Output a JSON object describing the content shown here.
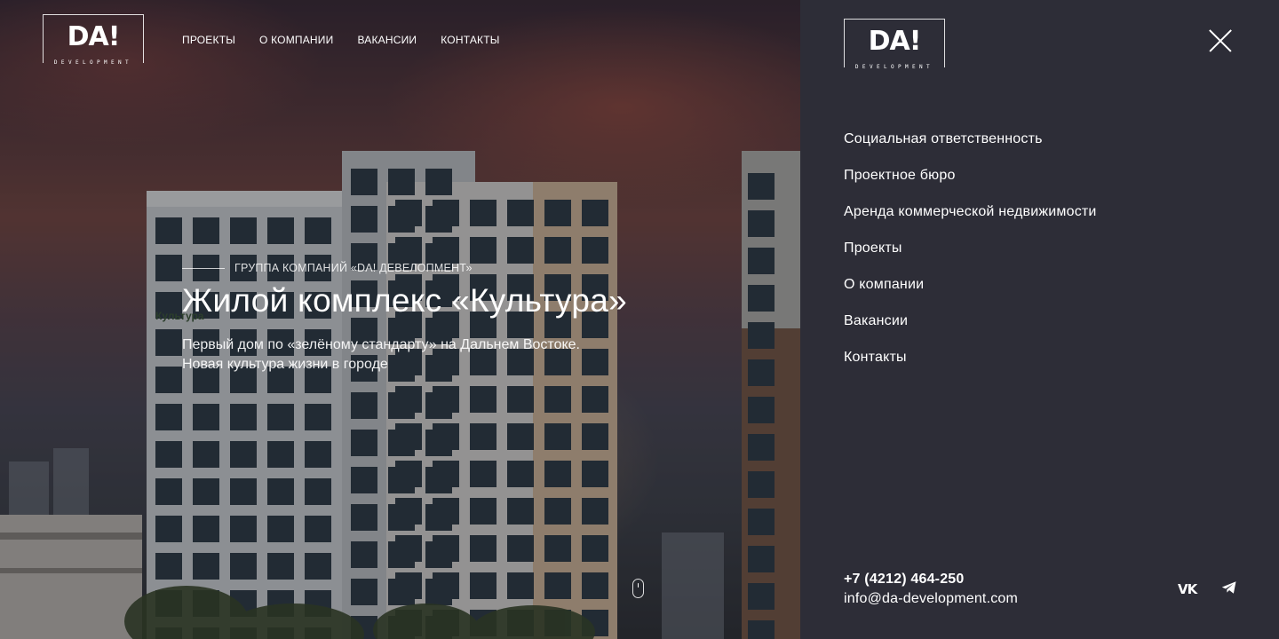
{
  "brand": {
    "logo_mark": "DA!",
    "logo_sub": "DEVELOPMENT"
  },
  "topnav": {
    "items": [
      "ПРОЕКТЫ",
      "О КОМПАНИИ",
      "ВАКАНСИИ",
      "КОНТАКТЫ"
    ]
  },
  "hero": {
    "eyebrow": "ГРУППА КОМПАНИЙ «DA! ДЕВЕЛОПМЕНТ»",
    "title": "Жилой комплекс «Культура»",
    "desc_line1": "Первый дом по «зелёному стандарту» на Дальнем Востоке.",
    "desc_line2": "Новая культура жизни в городе",
    "building_sign": "Культура"
  },
  "panel": {
    "menu": [
      "Социальная ответственность",
      "Проектное бюро",
      "Аренда коммерческой недвижимости",
      "Проекты",
      "О компании",
      "Вакансии",
      "Контакты"
    ],
    "phone": "+7 (4212) 464-250",
    "email": "info@da-development.com",
    "social": {
      "vk_label": "vk",
      "telegram_icon": "telegram-icon"
    },
    "close_icon": "close-icon"
  },
  "colors": {
    "panel_bg": "#2d2d37",
    "text": "#ffffff"
  }
}
